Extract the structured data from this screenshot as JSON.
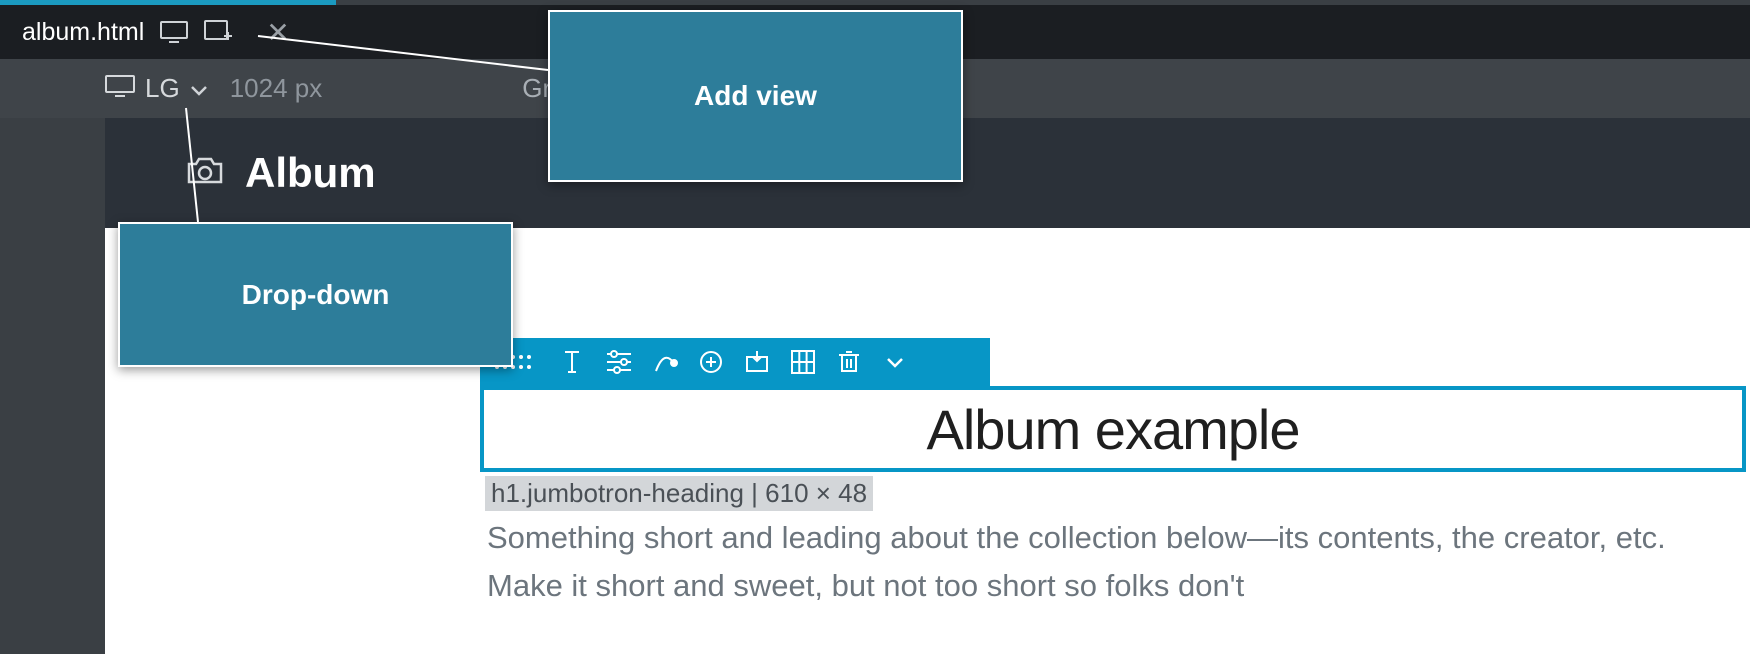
{
  "tab": {
    "filename": "album.html"
  },
  "breakpoint": {
    "label": "LG",
    "width_px": "1024 px",
    "grid_label": "Grid"
  },
  "site": {
    "brand": "Album"
  },
  "selection": {
    "heading": "Album example",
    "selector_label": "h1.jumbotron-heading | 610 × 48"
  },
  "content": {
    "lead": "Something short and leading about the collection below—its contents, the creator, etc. Make it short and sweet, but not too short so folks don't"
  },
  "callouts": {
    "add_view": "Add view",
    "dropdown": "Drop-down"
  }
}
